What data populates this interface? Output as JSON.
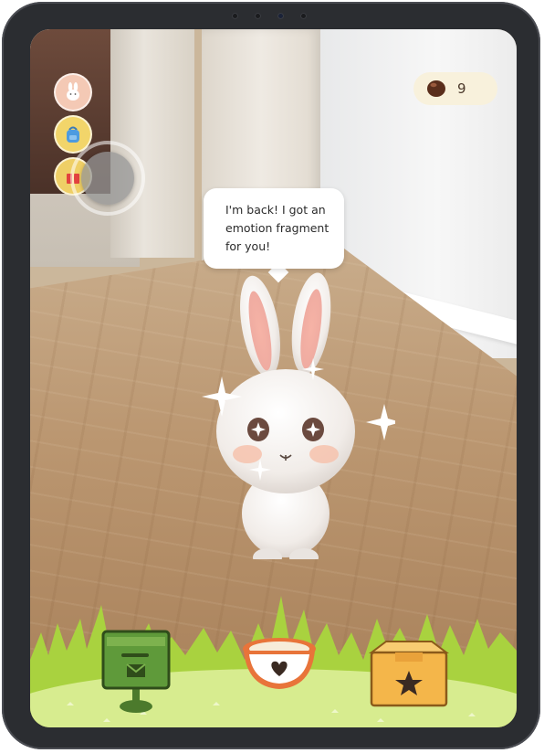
{
  "top_bar": {
    "currency_count": "9",
    "currency_icon": "brown-bean-icon"
  },
  "side_buttons": [
    {
      "name": "pet",
      "icon": "bunny-face-icon"
    },
    {
      "name": "backpack",
      "icon": "backpack-icon"
    },
    {
      "name": "gift",
      "icon": "gift-icon"
    }
  ],
  "speech": {
    "line1": "I'm back! I got an",
    "line2": "emotion fragment",
    "line3": "for you!"
  },
  "bottom_items": [
    {
      "name": "mailbox",
      "icon": "envelope-icon",
      "color": "#5f9a3a"
    },
    {
      "name": "food-bowl",
      "icon": "heart-icon",
      "color": "#e8743a"
    },
    {
      "name": "star-box",
      "icon": "star-icon",
      "color": "#f4b64a"
    }
  ],
  "colors": {
    "grass": "#a9d23f",
    "grass_light": "#d7ec8f",
    "frame": "#2b2d31"
  }
}
